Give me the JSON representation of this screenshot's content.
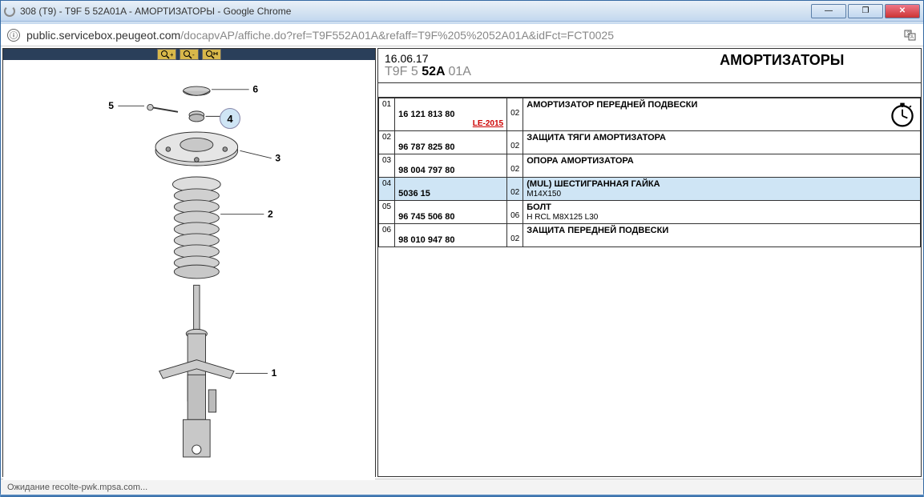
{
  "window": {
    "title": "308 (T9) - T9F 5 52A01A - АМОРТИЗАТОРЫ - Google Chrome"
  },
  "address": {
    "host": "public.servicebox.peugeot.com",
    "path": "/docapvAP/affiche.do?ref=T9F552A01A&refaff=T9F%205%2052A01A&idFct=FCT0025"
  },
  "header": {
    "date": "16.06.17",
    "code_prefix": "T9F 5",
    "code_bold": " 52A ",
    "code_suffix": "01A",
    "title": "АМОРТИЗАТОРЫ"
  },
  "diagram": {
    "callouts": [
      "1",
      "2",
      "3",
      "4",
      "5",
      "6"
    ],
    "highlighted": "4"
  },
  "zoom": {
    "in": "🔍+",
    "out": "🔍-",
    "fit": "🔍↔"
  },
  "parts": [
    {
      "idx": "01",
      "part": "16 121 813 80",
      "qty": "02",
      "desc": "АМОРТИЗАТОР ПЕРЕДНЕЙ ПОДВЕСКИ",
      "sub": "",
      "extra": "LE-2015",
      "icon": true
    },
    {
      "idx": "02",
      "part": "96 787 825 80",
      "qty": "02",
      "desc": "ЗАЩИТА ТЯГИ АМОРТИЗАТОРА",
      "sub": ""
    },
    {
      "idx": "03",
      "part": "98 004 797 80",
      "qty": "02",
      "desc": "ОПОРА АМОРТИЗАТОРА",
      "sub": ""
    },
    {
      "idx": "04",
      "part": "5036 15",
      "qty": "02",
      "desc": "(MUL) ШЕСТИГРАННАЯ ГАЙКА",
      "sub": "M14X150",
      "highlight": true
    },
    {
      "idx": "05",
      "part": "96 745 506 80",
      "qty": "06",
      "desc": "БОЛТ",
      "sub": "H RCL M8X125 L30"
    },
    {
      "idx": "06",
      "part": "98 010 947 80",
      "qty": "02",
      "desc": "ЗАЩИТА ПЕРЕДНЕЙ ПОДВЕСКИ",
      "sub": ""
    }
  ],
  "status": "Ожидание recolte-pwk.mpsa.com..."
}
